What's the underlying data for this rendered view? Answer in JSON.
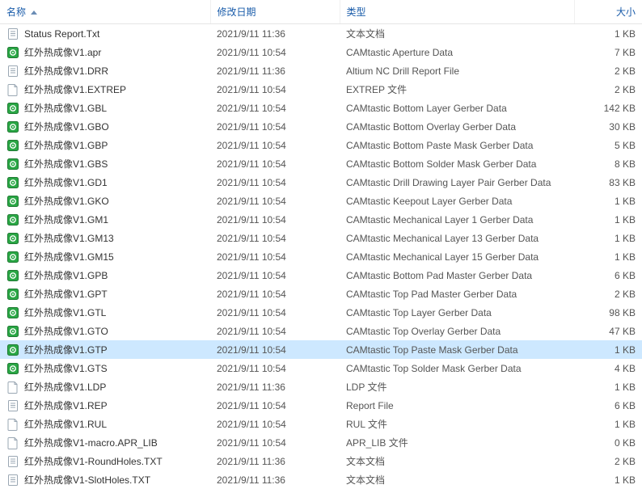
{
  "columns": {
    "name": "名称",
    "date": "修改日期",
    "type": "类型",
    "size": "大小"
  },
  "selected_index": 17,
  "icons": {
    "txt": "txt-icon",
    "cam": "camtastic-icon",
    "generic": "generic-file-icon"
  },
  "files": [
    {
      "icon": "txt",
      "name": "Status Report.Txt",
      "date": "2021/9/11 11:36",
      "type": "文本文档",
      "size": "1 KB"
    },
    {
      "icon": "cam",
      "name": "红外热成像V1.apr",
      "date": "2021/9/11 10:54",
      "type": "CAMtastic Aperture Data",
      "size": "7 KB"
    },
    {
      "icon": "txt",
      "name": "红外热成像V1.DRR",
      "date": "2021/9/11 11:36",
      "type": "Altium NC Drill Report File",
      "size": "2 KB"
    },
    {
      "icon": "generic",
      "name": "红外热成像V1.EXTREP",
      "date": "2021/9/11 10:54",
      "type": "EXTREP 文件",
      "size": "2 KB"
    },
    {
      "icon": "cam",
      "name": "红外热成像V1.GBL",
      "date": "2021/9/11 10:54",
      "type": "CAMtastic Bottom Layer Gerber Data",
      "size": "142 KB"
    },
    {
      "icon": "cam",
      "name": "红外热成像V1.GBO",
      "date": "2021/9/11 10:54",
      "type": "CAMtastic Bottom Overlay Gerber Data",
      "size": "30 KB"
    },
    {
      "icon": "cam",
      "name": "红外热成像V1.GBP",
      "date": "2021/9/11 10:54",
      "type": "CAMtastic Bottom Paste Mask Gerber Data",
      "size": "5 KB"
    },
    {
      "icon": "cam",
      "name": "红外热成像V1.GBS",
      "date": "2021/9/11 10:54",
      "type": "CAMtastic Bottom Solder Mask Gerber Data",
      "size": "8 KB"
    },
    {
      "icon": "cam",
      "name": "红外热成像V1.GD1",
      "date": "2021/9/11 10:54",
      "type": "CAMtastic Drill Drawing Layer Pair Gerber Data",
      "size": "83 KB"
    },
    {
      "icon": "cam",
      "name": "红外热成像V1.GKO",
      "date": "2021/9/11 10:54",
      "type": "CAMtastic Keepout Layer Gerber Data",
      "size": "1 KB"
    },
    {
      "icon": "cam",
      "name": "红外热成像V1.GM1",
      "date": "2021/9/11 10:54",
      "type": "CAMtastic Mechanical Layer 1 Gerber Data",
      "size": "1 KB"
    },
    {
      "icon": "cam",
      "name": "红外热成像V1.GM13",
      "date": "2021/9/11 10:54",
      "type": "CAMtastic Mechanical Layer 13 Gerber Data",
      "size": "1 KB"
    },
    {
      "icon": "cam",
      "name": "红外热成像V1.GM15",
      "date": "2021/9/11 10:54",
      "type": "CAMtastic Mechanical Layer 15 Gerber Data",
      "size": "1 KB"
    },
    {
      "icon": "cam",
      "name": "红外热成像V1.GPB",
      "date": "2021/9/11 10:54",
      "type": "CAMtastic Bottom Pad Master Gerber Data",
      "size": "6 KB"
    },
    {
      "icon": "cam",
      "name": "红外热成像V1.GPT",
      "date": "2021/9/11 10:54",
      "type": "CAMtastic Top Pad Master Gerber Data",
      "size": "2 KB"
    },
    {
      "icon": "cam",
      "name": "红外热成像V1.GTL",
      "date": "2021/9/11 10:54",
      "type": "CAMtastic Top Layer Gerber Data",
      "size": "98 KB"
    },
    {
      "icon": "cam",
      "name": "红外热成像V1.GTO",
      "date": "2021/9/11 10:54",
      "type": "CAMtastic Top Overlay Gerber Data",
      "size": "47 KB"
    },
    {
      "icon": "cam",
      "name": "红外热成像V1.GTP",
      "date": "2021/9/11 10:54",
      "type": "CAMtastic Top Paste Mask Gerber Data",
      "size": "1 KB"
    },
    {
      "icon": "cam",
      "name": "红外热成像V1.GTS",
      "date": "2021/9/11 10:54",
      "type": "CAMtastic Top Solder Mask Gerber Data",
      "size": "4 KB"
    },
    {
      "icon": "generic",
      "name": "红外热成像V1.LDP",
      "date": "2021/9/11 11:36",
      "type": "LDP 文件",
      "size": "1 KB"
    },
    {
      "icon": "txt",
      "name": "红外热成像V1.REP",
      "date": "2021/9/11 10:54",
      "type": "Report File",
      "size": "6 KB"
    },
    {
      "icon": "generic",
      "name": "红外热成像V1.RUL",
      "date": "2021/9/11 10:54",
      "type": "RUL 文件",
      "size": "1 KB"
    },
    {
      "icon": "generic",
      "name": "红外热成像V1-macro.APR_LIB",
      "date": "2021/9/11 10:54",
      "type": "APR_LIB 文件",
      "size": "0 KB"
    },
    {
      "icon": "txt",
      "name": "红外热成像V1-RoundHoles.TXT",
      "date": "2021/9/11 11:36",
      "type": "文本文档",
      "size": "2 KB"
    },
    {
      "icon": "txt",
      "name": "红外热成像V1-SlotHoles.TXT",
      "date": "2021/9/11 11:36",
      "type": "文本文档",
      "size": "1 KB"
    }
  ]
}
